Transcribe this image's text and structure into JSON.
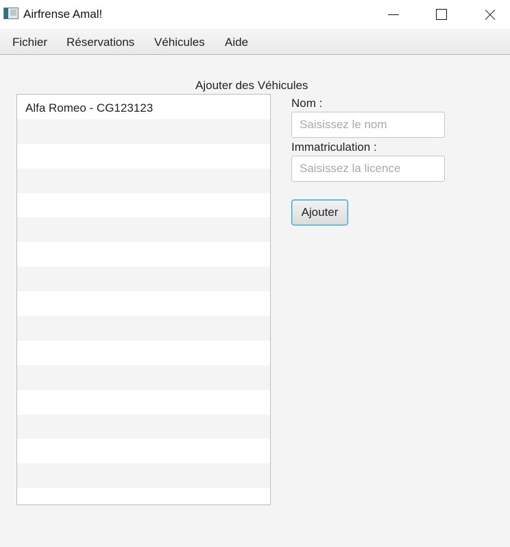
{
  "window": {
    "title": "Airfrense Amal!",
    "controls": [
      "minimize",
      "maximize",
      "close"
    ]
  },
  "menubar": {
    "items": [
      {
        "label": "Fichier"
      },
      {
        "label": "Réservations"
      },
      {
        "label": "Véhicules"
      },
      {
        "label": "Aide"
      }
    ]
  },
  "main": {
    "panel_title": "Ajouter des Véhicules",
    "vehicle_list": {
      "items": [
        "Alfa Romeo - CG123123"
      ]
    },
    "form": {
      "name_label": "Nom :",
      "name_placeholder": "Saisissez le nom",
      "plate_label": "Immatriculation :",
      "plate_placeholder": "Saisissez la licence",
      "submit_label": "Ajouter"
    }
  },
  "colors": {
    "focus_accent": "#2aa4d8",
    "background": "#f4f4f4",
    "list_alt_row": "#f4f4f4"
  }
}
